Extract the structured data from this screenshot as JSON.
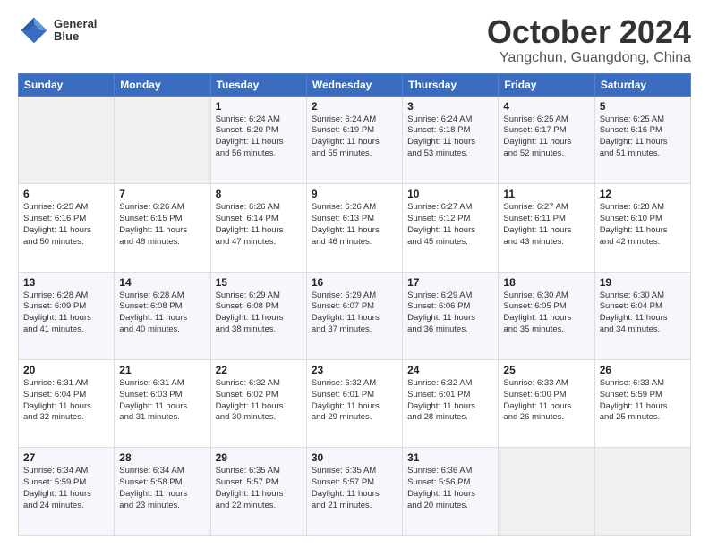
{
  "header": {
    "logo": {
      "line1": "General",
      "line2": "Blue"
    },
    "title": "October 2024",
    "subtitle": "Yangchun, Guangdong, China"
  },
  "columns": [
    "Sunday",
    "Monday",
    "Tuesday",
    "Wednesday",
    "Thursday",
    "Friday",
    "Saturday"
  ],
  "weeks": [
    [
      {
        "day": "",
        "lines": []
      },
      {
        "day": "",
        "lines": []
      },
      {
        "day": "1",
        "lines": [
          "Sunrise: 6:24 AM",
          "Sunset: 6:20 PM",
          "Daylight: 11 hours",
          "and 56 minutes."
        ]
      },
      {
        "day": "2",
        "lines": [
          "Sunrise: 6:24 AM",
          "Sunset: 6:19 PM",
          "Daylight: 11 hours",
          "and 55 minutes."
        ]
      },
      {
        "day": "3",
        "lines": [
          "Sunrise: 6:24 AM",
          "Sunset: 6:18 PM",
          "Daylight: 11 hours",
          "and 53 minutes."
        ]
      },
      {
        "day": "4",
        "lines": [
          "Sunrise: 6:25 AM",
          "Sunset: 6:17 PM",
          "Daylight: 11 hours",
          "and 52 minutes."
        ]
      },
      {
        "day": "5",
        "lines": [
          "Sunrise: 6:25 AM",
          "Sunset: 6:16 PM",
          "Daylight: 11 hours",
          "and 51 minutes."
        ]
      }
    ],
    [
      {
        "day": "6",
        "lines": [
          "Sunrise: 6:25 AM",
          "Sunset: 6:16 PM",
          "Daylight: 11 hours",
          "and 50 minutes."
        ]
      },
      {
        "day": "7",
        "lines": [
          "Sunrise: 6:26 AM",
          "Sunset: 6:15 PM",
          "Daylight: 11 hours",
          "and 48 minutes."
        ]
      },
      {
        "day": "8",
        "lines": [
          "Sunrise: 6:26 AM",
          "Sunset: 6:14 PM",
          "Daylight: 11 hours",
          "and 47 minutes."
        ]
      },
      {
        "day": "9",
        "lines": [
          "Sunrise: 6:26 AM",
          "Sunset: 6:13 PM",
          "Daylight: 11 hours",
          "and 46 minutes."
        ]
      },
      {
        "day": "10",
        "lines": [
          "Sunrise: 6:27 AM",
          "Sunset: 6:12 PM",
          "Daylight: 11 hours",
          "and 45 minutes."
        ]
      },
      {
        "day": "11",
        "lines": [
          "Sunrise: 6:27 AM",
          "Sunset: 6:11 PM",
          "Daylight: 11 hours",
          "and 43 minutes."
        ]
      },
      {
        "day": "12",
        "lines": [
          "Sunrise: 6:28 AM",
          "Sunset: 6:10 PM",
          "Daylight: 11 hours",
          "and 42 minutes."
        ]
      }
    ],
    [
      {
        "day": "13",
        "lines": [
          "Sunrise: 6:28 AM",
          "Sunset: 6:09 PM",
          "Daylight: 11 hours",
          "and 41 minutes."
        ]
      },
      {
        "day": "14",
        "lines": [
          "Sunrise: 6:28 AM",
          "Sunset: 6:08 PM",
          "Daylight: 11 hours",
          "and 40 minutes."
        ]
      },
      {
        "day": "15",
        "lines": [
          "Sunrise: 6:29 AM",
          "Sunset: 6:08 PM",
          "Daylight: 11 hours",
          "and 38 minutes."
        ]
      },
      {
        "day": "16",
        "lines": [
          "Sunrise: 6:29 AM",
          "Sunset: 6:07 PM",
          "Daylight: 11 hours",
          "and 37 minutes."
        ]
      },
      {
        "day": "17",
        "lines": [
          "Sunrise: 6:29 AM",
          "Sunset: 6:06 PM",
          "Daylight: 11 hours",
          "and 36 minutes."
        ]
      },
      {
        "day": "18",
        "lines": [
          "Sunrise: 6:30 AM",
          "Sunset: 6:05 PM",
          "Daylight: 11 hours",
          "and 35 minutes."
        ]
      },
      {
        "day": "19",
        "lines": [
          "Sunrise: 6:30 AM",
          "Sunset: 6:04 PM",
          "Daylight: 11 hours",
          "and 34 minutes."
        ]
      }
    ],
    [
      {
        "day": "20",
        "lines": [
          "Sunrise: 6:31 AM",
          "Sunset: 6:04 PM",
          "Daylight: 11 hours",
          "and 32 minutes."
        ]
      },
      {
        "day": "21",
        "lines": [
          "Sunrise: 6:31 AM",
          "Sunset: 6:03 PM",
          "Daylight: 11 hours",
          "and 31 minutes."
        ]
      },
      {
        "day": "22",
        "lines": [
          "Sunrise: 6:32 AM",
          "Sunset: 6:02 PM",
          "Daylight: 11 hours",
          "and 30 minutes."
        ]
      },
      {
        "day": "23",
        "lines": [
          "Sunrise: 6:32 AM",
          "Sunset: 6:01 PM",
          "Daylight: 11 hours",
          "and 29 minutes."
        ]
      },
      {
        "day": "24",
        "lines": [
          "Sunrise: 6:32 AM",
          "Sunset: 6:01 PM",
          "Daylight: 11 hours",
          "and 28 minutes."
        ]
      },
      {
        "day": "25",
        "lines": [
          "Sunrise: 6:33 AM",
          "Sunset: 6:00 PM",
          "Daylight: 11 hours",
          "and 26 minutes."
        ]
      },
      {
        "day": "26",
        "lines": [
          "Sunrise: 6:33 AM",
          "Sunset: 5:59 PM",
          "Daylight: 11 hours",
          "and 25 minutes."
        ]
      }
    ],
    [
      {
        "day": "27",
        "lines": [
          "Sunrise: 6:34 AM",
          "Sunset: 5:59 PM",
          "Daylight: 11 hours",
          "and 24 minutes."
        ]
      },
      {
        "day": "28",
        "lines": [
          "Sunrise: 6:34 AM",
          "Sunset: 5:58 PM",
          "Daylight: 11 hours",
          "and 23 minutes."
        ]
      },
      {
        "day": "29",
        "lines": [
          "Sunrise: 6:35 AM",
          "Sunset: 5:57 PM",
          "Daylight: 11 hours",
          "and 22 minutes."
        ]
      },
      {
        "day": "30",
        "lines": [
          "Sunrise: 6:35 AM",
          "Sunset: 5:57 PM",
          "Daylight: 11 hours",
          "and 21 minutes."
        ]
      },
      {
        "day": "31",
        "lines": [
          "Sunrise: 6:36 AM",
          "Sunset: 5:56 PM",
          "Daylight: 11 hours",
          "and 20 minutes."
        ]
      },
      {
        "day": "",
        "lines": []
      },
      {
        "day": "",
        "lines": []
      }
    ]
  ]
}
